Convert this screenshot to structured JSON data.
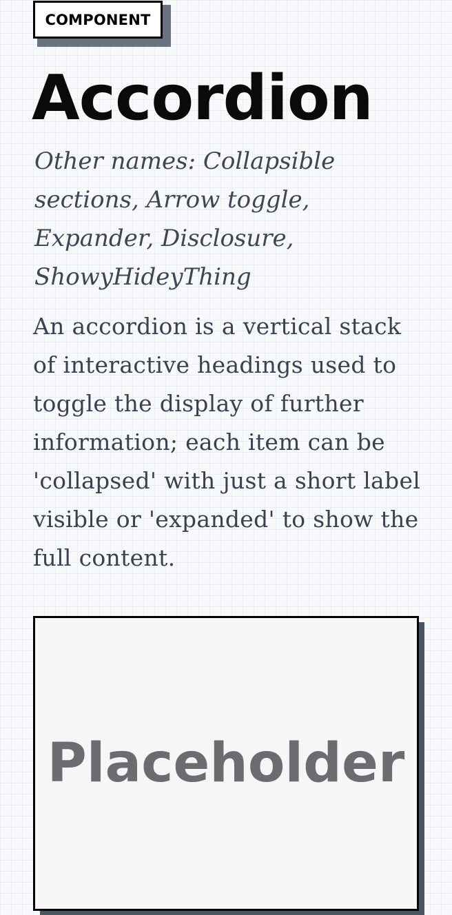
{
  "header": {
    "tag_label": "COMPONENT",
    "title": "Accordion"
  },
  "content": {
    "other_names": "Other names: Collapsible sections, Arrow toggle, Expander, Disclosure, ShowyHideyThing",
    "description": "An accordion is a vertical stack of interactive headings used to toggle the display of further information; each item can be 'collapsed' with just a short label visible or 'expanded' to show the full content."
  },
  "preview": {
    "placeholder_label": "Placeholder"
  },
  "colors": {
    "background": "#f8f9fb",
    "grid_line": "#eceef2",
    "text_primary": "#0a0a0a",
    "text_secondary": "#3f4653",
    "shadow": "#6b7280",
    "placeholder_bg": "#f6f6f6",
    "placeholder_text": "#6b6c70"
  }
}
